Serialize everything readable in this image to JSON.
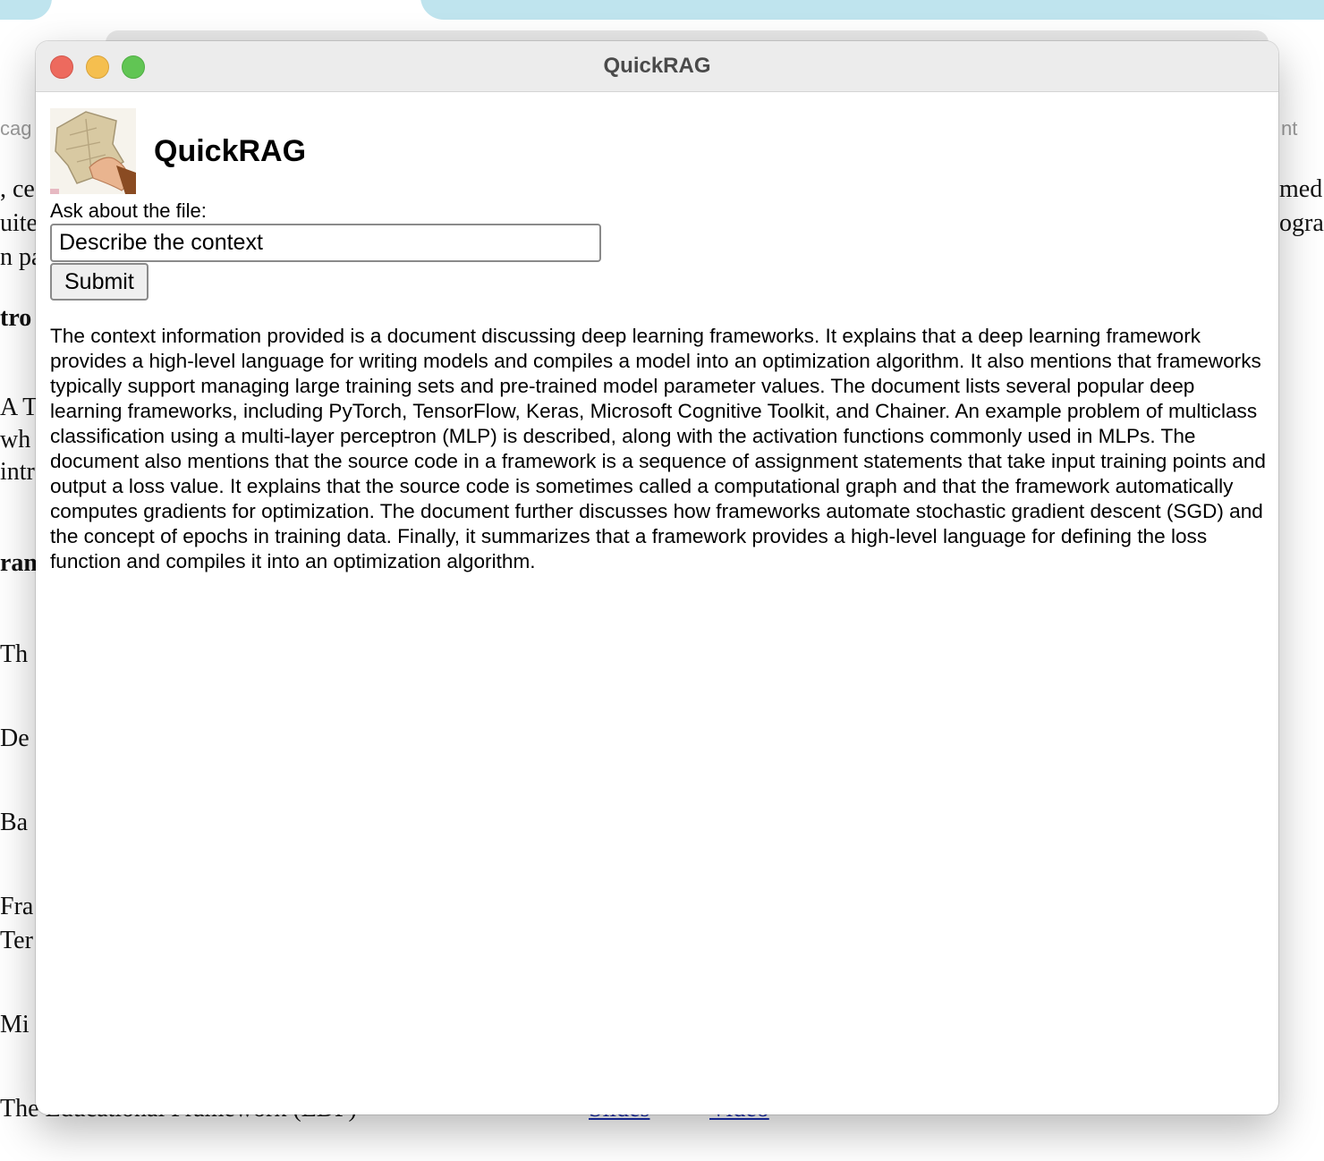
{
  "window": {
    "title": "QuickRAG"
  },
  "app": {
    "title": "QuickRAG",
    "logo_icon": "cloth-in-hand-logo"
  },
  "form": {
    "label": "Ask about the file:",
    "query_value": "Describe the context",
    "submit_label": "Submit"
  },
  "answer": {
    "text": "The context information provided is a document discussing deep learning frameworks. It explains that a deep learning framework provides a high-level language for writing models and compiles a model into an optimization algorithm. It also mentions that frameworks typically support managing large training sets and pre-trained model parameter values. The document lists several popular deep learning frameworks, including PyTorch, TensorFlow, Keras, Microsoft Cognitive Toolkit, and Chainer. An example problem of multiclass classification using a multi-layer perceptron (MLP) is described, along with the activation functions commonly used in MLPs. The document also mentions that the source code in a framework is a sequence of assignment statements that take input training points and output a loss value. It explains that the source code is sometimes called a computational graph and that the framework automatically computes gradients for optimization. The document further discusses how frameworks automate stochastic gradient descent (SGD) and the concept of epochs in training data. Finally, it summarizes that a framework provides a high-level language for defining the loss function and compiles it into an optimization algorithm."
  },
  "background_page": {
    "left_fragments": [
      "cag",
      ", ce",
      "uite",
      "n pa",
      "tro",
      "A T",
      "wh",
      "intr",
      "ram",
      "Th",
      "De",
      "Ba",
      "Fra",
      "Ter",
      "Mi"
    ],
    "right_fragments": [
      "nt",
      "med",
      "ogra"
    ],
    "bottom_text": "The Educational Framework (EDF)",
    "bottom_links": [
      "Slides",
      "Video"
    ]
  },
  "colors": {
    "close": "#ed6a5e",
    "minimize": "#f5bf4f",
    "maximize": "#61c554",
    "titlebar": "#ececec",
    "background_tab": "#bfe4ee"
  }
}
